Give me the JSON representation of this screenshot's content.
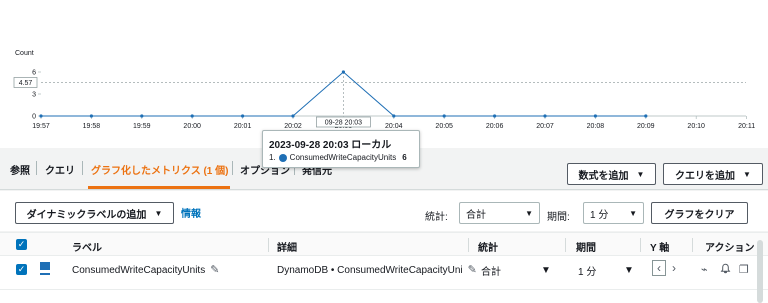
{
  "chart": {
    "y_label": "Count",
    "y_ticks": [
      "6",
      "3",
      "0"
    ],
    "y_highlight": "4.57",
    "x_ticks": [
      "19:57",
      "19:58",
      "19:59",
      "20:00",
      "20:01",
      "20:02",
      "20:03",
      "20:04",
      "20:05",
      "20:06",
      "20:07",
      "20:08",
      "20:09",
      "20:10",
      "20:11"
    ],
    "crosshair_label": "09-28 20:03",
    "line_color": "#1f6fb5"
  },
  "chart_data": {
    "type": "line",
    "ylabel": "Count",
    "xlabel": "",
    "ylim": [
      0,
      6
    ],
    "x": [
      "19:57",
      "19:58",
      "19:59",
      "20:00",
      "20:01",
      "20:02",
      "20:03",
      "20:04",
      "20:05",
      "20:06",
      "20:07",
      "20:08",
      "20:09"
    ],
    "series": [
      {
        "name": "ConsumedWriteCapacityUnits",
        "values": [
          0,
          0,
          0,
          0,
          0,
          0,
          6,
          0,
          0,
          0,
          0,
          0,
          0
        ]
      }
    ],
    "horizontal_line": 4.57
  },
  "tooltip": {
    "title": "2023-09-28 20:03 ローカル",
    "index": "1.",
    "metric": "ConsumedWriteCapacityUnits",
    "value": "6"
  },
  "tabs": {
    "items": [
      "参照",
      "クエリ",
      "グラフ化したメトリクス (1 個)",
      "オプション",
      "発信元"
    ],
    "active_index": 2
  },
  "buttons": {
    "add_formula": "数式を追加",
    "add_query": "クエリを追加",
    "add_dynamic_label": "ダイナミックラベルの追加",
    "info": "情報",
    "clear_graph": "グラフをクリア"
  },
  "toolbar": {
    "stat_label": "統計:",
    "stat_value": "合計",
    "period_label": "期間:",
    "period_value": "1 分"
  },
  "table": {
    "headers": [
      "ラベル",
      "詳細",
      "統計",
      "期間",
      "Y 軸",
      "アクション"
    ],
    "rows": [
      {
        "label": "ConsumedWriteCapacityUnits",
        "details": "DynamoDB • ConsumedWriteCapacityUni",
        "stat": "合計",
        "period": "1 分"
      }
    ]
  },
  "icons": {
    "caret": "▼",
    "check": "✓",
    "pencil": "✎",
    "chevron_left": "‹",
    "chevron_right": "›",
    "anomaly": "⌁",
    "bell": "🔔",
    "copy": "❐"
  }
}
